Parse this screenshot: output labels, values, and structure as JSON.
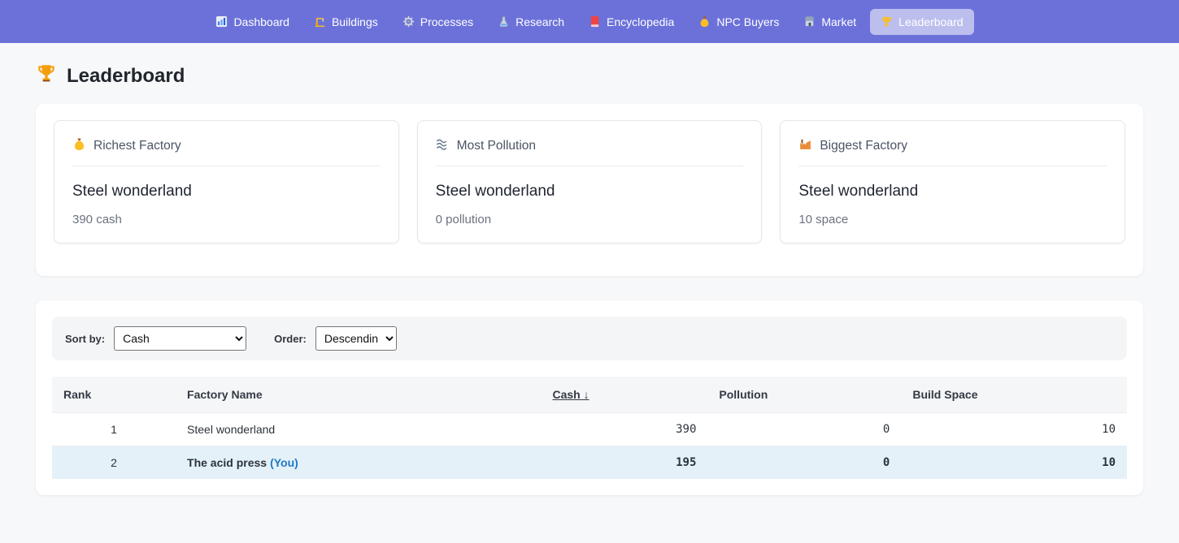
{
  "nav": {
    "items": [
      {
        "icon": "bar-chart",
        "label": "Dashboard",
        "active": false
      },
      {
        "icon": "crane",
        "label": "Buildings",
        "active": false
      },
      {
        "icon": "gear",
        "label": "Processes",
        "active": false
      },
      {
        "icon": "flask",
        "label": "Research",
        "active": false
      },
      {
        "icon": "book",
        "label": "Encyclopedia",
        "active": false
      },
      {
        "icon": "money-bag",
        "label": "NPC Buyers",
        "active": false
      },
      {
        "icon": "store",
        "label": "Market",
        "active": false
      },
      {
        "icon": "trophy",
        "label": "Leaderboard",
        "active": true
      }
    ]
  },
  "page": {
    "icon": "trophy",
    "title": "Leaderboard"
  },
  "stat_cards": [
    {
      "icon": "money-bag",
      "title": "Richest Factory",
      "factory": "Steel wonderland",
      "value": "390 cash"
    },
    {
      "icon": "waves",
      "title": "Most Pollution",
      "factory": "Steel wonderland",
      "value": "0 pollution"
    },
    {
      "icon": "factory",
      "title": "Biggest Factory",
      "factory": "Steel wonderland",
      "value": "10 space"
    }
  ],
  "filters": {
    "sort_by_label": "Sort by:",
    "sort_by_value": "Cash",
    "order_label": "Order:",
    "order_value": "Descending"
  },
  "table": {
    "headers": {
      "rank": "Rank",
      "name": "Factory Name",
      "cash": "Cash ↓",
      "pollution": "Pollution",
      "space": "Build Space"
    },
    "rows": [
      {
        "rank": "1",
        "name": "Steel wonderland",
        "you": "",
        "cash": "390",
        "pollution": "0",
        "space": "10",
        "highlighted": false
      },
      {
        "rank": "2",
        "name": "The acid press",
        "you": "(You)",
        "cash": "195",
        "pollution": "0",
        "space": "10",
        "highlighted": true
      }
    ]
  },
  "colors": {
    "nav_bg": "#6c71da",
    "nav_active_pill": "rgba(255,255,255,0.55)",
    "highlight_row": "#e4f1f8",
    "you_link": "#1e78c8",
    "page_bg": "#f7f8fa"
  }
}
